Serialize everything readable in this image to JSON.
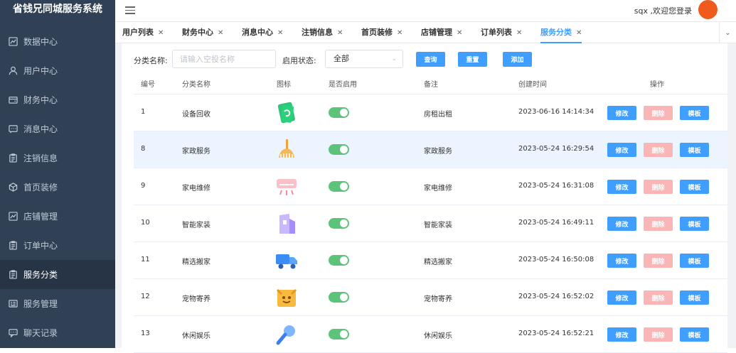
{
  "app": {
    "title": "省钱兄同城服务系统"
  },
  "sidebar": {
    "items": [
      {
        "label": "数据中心",
        "icon": "chart-icon"
      },
      {
        "label": "用户中心",
        "icon": "user-icon"
      },
      {
        "label": "财务中心",
        "icon": "wallet-icon"
      },
      {
        "label": "消息中心",
        "icon": "message-icon"
      },
      {
        "label": "注销信息",
        "icon": "clipboard-icon"
      },
      {
        "label": "首页装修",
        "icon": "cube-icon"
      },
      {
        "label": "店铺管理",
        "icon": "chart-icon"
      },
      {
        "label": "订单中心",
        "icon": "clipboard-icon"
      },
      {
        "label": "服务分类",
        "icon": "clipboard-icon",
        "active": true
      },
      {
        "label": "服务管理",
        "icon": "list-icon"
      },
      {
        "label": "聊天记录",
        "icon": "chat-icon"
      }
    ]
  },
  "header": {
    "welcome": "sqx ,欢迎您登录"
  },
  "tabs": [
    {
      "label": "用户列表"
    },
    {
      "label": "财务中心"
    },
    {
      "label": "消息中心"
    },
    {
      "label": "注销信息"
    },
    {
      "label": "首页装修"
    },
    {
      "label": "店铺管理"
    },
    {
      "label": "订单列表"
    },
    {
      "label": "服务分类",
      "active": true
    }
  ],
  "filter": {
    "name_label": "分类名称:",
    "name_placeholder": "请输入空投名称",
    "status_label": "启用状态:",
    "status_value": "全部",
    "search_button": "查询",
    "reset_button": "重置",
    "add_button": "添加"
  },
  "table": {
    "columns": [
      "编号",
      "分类名称",
      "图标",
      "是否启用",
      "备注",
      "创建时间",
      "操作"
    ],
    "rows": [
      {
        "id": "1",
        "name": "设备回收",
        "icon": "phone-recycle-icon",
        "enabled": true,
        "remark": "房租出租",
        "created": "2023-06-16 14:14:34"
      },
      {
        "id": "8",
        "name": "家政服务",
        "icon": "broom-icon",
        "enabled": true,
        "remark": "家政服务",
        "created": "2023-05-24 16:29:54"
      },
      {
        "id": "9",
        "name": "家电维修",
        "icon": "air-conditioner-icon",
        "enabled": true,
        "remark": "家电维修",
        "created": "2023-05-24 16:31:08"
      },
      {
        "id": "10",
        "name": "智能家装",
        "icon": "building-icon",
        "enabled": true,
        "remark": "智能家装",
        "created": "2023-05-24 16:49:11"
      },
      {
        "id": "11",
        "name": "精选搬家",
        "icon": "truck-icon",
        "enabled": true,
        "remark": "精选搬家",
        "created": "2023-05-24 16:50:08"
      },
      {
        "id": "12",
        "name": "宠物寄养",
        "icon": "pet-icon",
        "enabled": true,
        "remark": "宠物寄养",
        "created": "2023-05-24 16:52:02"
      },
      {
        "id": "13",
        "name": "休闲娱乐",
        "icon": "microphone-icon",
        "enabled": true,
        "remark": "休闲娱乐",
        "created": "2023-05-24 16:52:21"
      }
    ],
    "actions": {
      "edit": "修改",
      "delete": "删除",
      "template": "模板"
    }
  },
  "colors": {
    "sidebar_bg": "#304156",
    "primary": "#409eff",
    "danger_disabled": "#fab6b6",
    "switch_on": "#5cc47a",
    "row_highlight": "#ecf5ff"
  }
}
